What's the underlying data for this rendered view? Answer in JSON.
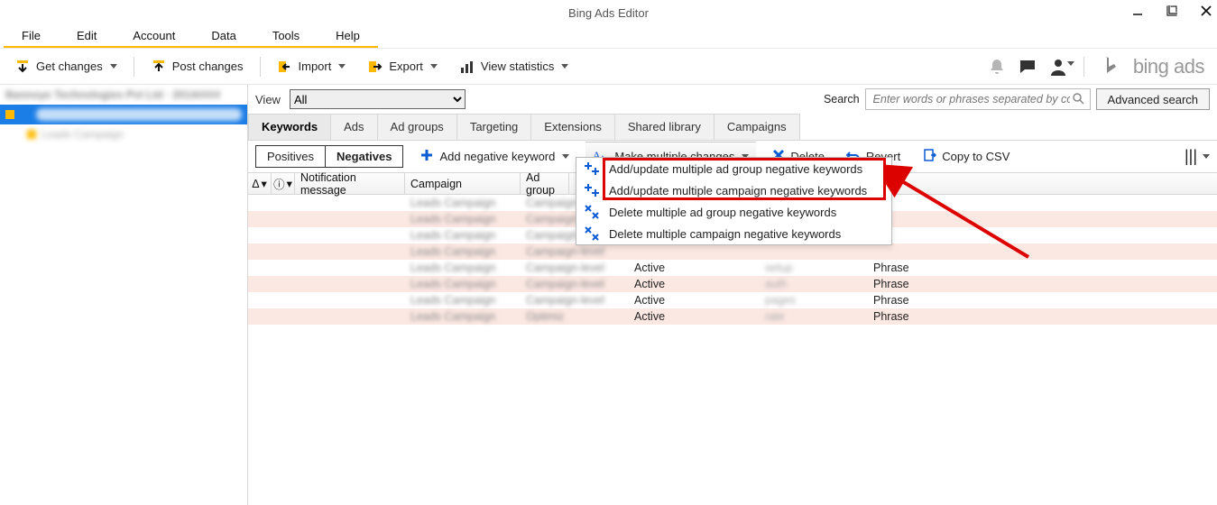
{
  "window": {
    "title": "Bing Ads Editor"
  },
  "menus": {
    "file": "File",
    "edit": "Edit",
    "account": "Account",
    "data": "Data",
    "tools": "Tools",
    "help": "Help"
  },
  "toolbar": {
    "get_changes": "Get changes",
    "post_changes": "Post changes",
    "import": "Import",
    "export": "Export",
    "view_stats": "View statistics"
  },
  "brand": {
    "text": "bing ads"
  },
  "left": {
    "account_blur": "Bannoye Technologies Pvt Ltd · 2014####",
    "selected_item": "Bannoye Technologies Pvt",
    "child_blur": "Leads Campaign"
  },
  "view": {
    "label": "View",
    "selected": "All"
  },
  "search": {
    "label": "Search",
    "placeholder": "Enter words or phrases separated by co",
    "advanced": "Advanced search"
  },
  "tabs": {
    "keywords": "Keywords",
    "ads": "Ads",
    "adgroups": "Ad groups",
    "targeting": "Targeting",
    "extensions": "Extensions",
    "shared": "Shared library",
    "campaigns": "Campaigns"
  },
  "sub": {
    "positives": "Positives",
    "negatives": "Negatives"
  },
  "actions": {
    "add_neg_kw": "Add negative keyword",
    "make_multiple": "Make multiple changes",
    "delete": "Delete",
    "revert": "Revert",
    "copy_csv": "Copy to CSV"
  },
  "headers": {
    "delta": "Δ",
    "info": "ⓘ",
    "notification": "Notification message",
    "campaign": "Campaign",
    "adgroup": "Ad group"
  },
  "rows": [
    {
      "campaign": "Leads Campaign",
      "adgroup": "Campaign-level",
      "status": "",
      "kw": "",
      "match": ""
    },
    {
      "campaign": "Leads Campaign",
      "adgroup": "Campaign-level",
      "status": "",
      "kw": "",
      "match": ""
    },
    {
      "campaign": "Leads Campaign",
      "adgroup": "Campaign-level",
      "status": "",
      "kw": "",
      "match": ""
    },
    {
      "campaign": "Leads Campaign",
      "adgroup": "Campaign-level",
      "status": "",
      "kw": "",
      "match": ""
    },
    {
      "campaign": "Leads Campaign",
      "adgroup": "Campaign-level",
      "status": "Active",
      "kw": "setup",
      "match": "Phrase"
    },
    {
      "campaign": "Leads Campaign",
      "adgroup": "Campaign-level",
      "status": "Active",
      "kw": "auth",
      "match": "Phrase"
    },
    {
      "campaign": "Leads Campaign",
      "adgroup": "Campaign-level",
      "status": "Active",
      "kw": "pages",
      "match": "Phrase"
    },
    {
      "campaign": "Leads Campaign",
      "adgroup": "Optimiz",
      "status": "Active",
      "kw": "rate",
      "match": "Phrase"
    }
  ],
  "dropdown": {
    "i1": "Add/update multiple ad group negative keywords",
    "i2": "Add/update multiple campaign negative keywords",
    "i3": "Delete multiple ad group negative keywords",
    "i4": "Delete multiple campaign negative keywords"
  }
}
